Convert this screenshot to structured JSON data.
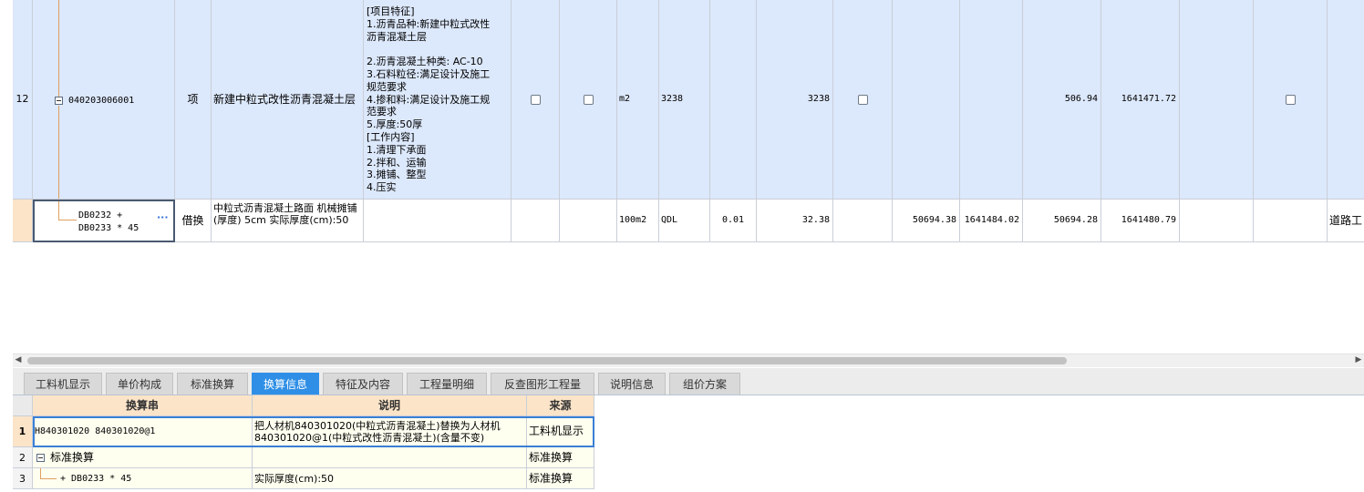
{
  "row1": {
    "number": "12",
    "code": "040203006001",
    "category": "项",
    "name": "新建中粒式改性沥青混凝土层",
    "features": [
      "[项目特征]",
      "1.沥青品种:新建中粒式改性",
      "沥青混凝土层",
      "",
      "2.沥青混凝土种类: AC-10",
      "3.石料粒径:满足设计及施工",
      "规范要求",
      "4.掺和料:满足设计及施工规",
      "范要求",
      "5.厚度:50厚",
      "[工作内容]",
      "1.清理下承面",
      "2.拌和、运输",
      "3.摊铺、整型",
      "4.压实"
    ],
    "unit": "m2",
    "quantity_expr": "3238",
    "quantity": "3238",
    "unit_price": "506.94",
    "total": "1641471.72"
  },
  "row2": {
    "code_line1": "DB0232 +",
    "code_line2": "DB0233 * 45",
    "ellipsis": "···",
    "category": "借换",
    "name": "中粒式沥青混凝土路面 机械摊铺(厚度) 5cm  实际厚度(cm):50",
    "unit": "100m2",
    "quantity_expr": "QDL",
    "content": "0.01",
    "quantity": "32.38",
    "price1": "50694.38",
    "total1": "1641484.02",
    "price2": "50694.28",
    "total2": "1641480.79",
    "profession": "道路工"
  },
  "tabs": [
    "工料机显示",
    "单价构成",
    "标准换算",
    "换算信息",
    "特征及内容",
    "工程量明细",
    "反查图形工程量",
    "说明信息",
    "组价方案"
  ],
  "active_tab": "换算信息",
  "conversion": {
    "headers": {
      "string": "换算串",
      "desc": "说明",
      "source": "来源"
    },
    "rows": [
      {
        "no": "1",
        "string": "H840301020 840301020@1",
        "desc": "把人材机840301020(中粒式沥青混凝土)替换为人材机840301020@1(中粒式改性沥青混凝土)(含量不变)",
        "source": "工料机显示"
      },
      {
        "no": "2",
        "string": "标准换算",
        "desc": "",
        "source": "标准换算"
      },
      {
        "no": "3",
        "string": "+ DB0233 * 45",
        "desc": "实际厚度(cm):50",
        "source": "标准换算"
      }
    ]
  }
}
